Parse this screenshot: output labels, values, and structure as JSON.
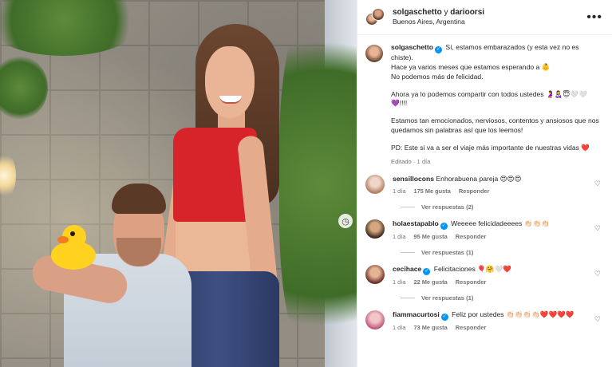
{
  "header": {
    "user1": "solgaschetto",
    "conjunction": "y",
    "user2": "darioorsi",
    "location": "Buenos Aires, Argentina",
    "more_icon": "more-horizontal-icon"
  },
  "caption": {
    "username": "solgaschetto",
    "line1": "Sí, estamos embarazados (y esta vez no es chiste).",
    "line2": "Hace ya varios meses que estamos esperando a 👶",
    "line3": "No podemos más de felicidad.",
    "line4": "Ahora ya lo podemos compartir con todos ustedes 🤰👩‍🍼😇🤍🤍",
    "line5": "💜!!!!",
    "line6": "Estamos tan emocionados, nerviosos, contentos y ansiosos que nos quedamos sin palabras así que los leemos!",
    "line7": "PD: Este si va a ser el viaje más importante de nuestras vidas ❤️",
    "edited": "Editado · 1 día"
  },
  "comments": [
    {
      "username": "sensillocons",
      "text": "Enhorabuena pareja 😍😍😍",
      "time": "1 día",
      "likes": "175 Me gusta",
      "reply": "Responder",
      "view_replies": "Ver respuestas (2)"
    },
    {
      "username": "holaestapablo",
      "text": "Weeeee felicidadeeees 👏🏻👏🏻👏🏻",
      "time": "1 día",
      "likes": "95 Me gusta",
      "reply": "Responder",
      "view_replies": "Ver respuestas (1)"
    },
    {
      "username": "cecihace",
      "text": "Felicitaciones 🎈🤗🤍❤️",
      "time": "1 día",
      "likes": "22 Me gusta",
      "reply": "Responder",
      "view_replies": "Ver respuestas (1)"
    },
    {
      "username": "fiammacurtosi",
      "text": "Feliz por ustedes 👏🏻👏🏻👏🏻👏🏻❤️❤️❤️❤️",
      "time": "1 día",
      "likes": "73 Me gusta",
      "reply": "Responder"
    }
  ],
  "icons": {
    "verified": "verified-badge-icon",
    "heart": "heart-outline-icon"
  },
  "colors": {
    "verified_blue": "#0095f6",
    "meta_gray": "#737373"
  }
}
